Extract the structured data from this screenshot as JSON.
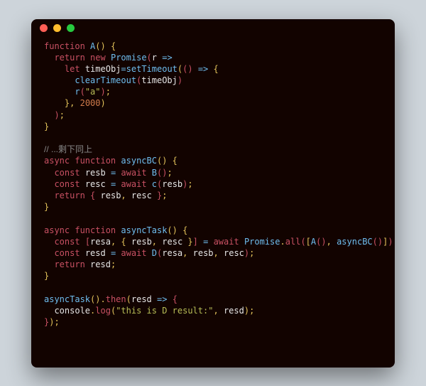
{
  "titlebar": {
    "close": "close",
    "minimize": "minimize",
    "zoom": "zoom"
  },
  "code": {
    "kw_function": "function",
    "kw_return": "return",
    "kw_new": "new",
    "kw_let": "let",
    "kw_const": "const",
    "kw_async": "async",
    "kw_await": "await",
    "type_Promise": "Promise",
    "fn_A": "A",
    "fn_setTimeout": "setTimeout",
    "fn_clearTimeout": "clearTimeout",
    "fn_asyncBC": "asyncBC",
    "fn_asyncTask": "asyncTask",
    "fn_B": "B",
    "fn_c": "c",
    "fn_D": "D",
    "fn_then": "then",
    "fn_log": "log",
    "id_r": "r",
    "id_timeObj": "timeObj",
    "id_resa": "resa",
    "id_resb": "resb",
    "id_resc": "resc",
    "id_resd": "resd",
    "id_console": "console",
    "prop_all": "all",
    "str_a": "\"a\"",
    "str_thisIsD": "\"this is D result:\"",
    "num_2000": "2000",
    "comment_rest": "// ...剩下同上",
    "arrow": "=>",
    "eq": "=",
    "semi": ";",
    "comma": ",",
    "dot": ".",
    "sp": " ",
    "lp": "(",
    "rp": ")",
    "lb": "{",
    "rb": "}",
    "ls": "[",
    "rs": "]"
  }
}
